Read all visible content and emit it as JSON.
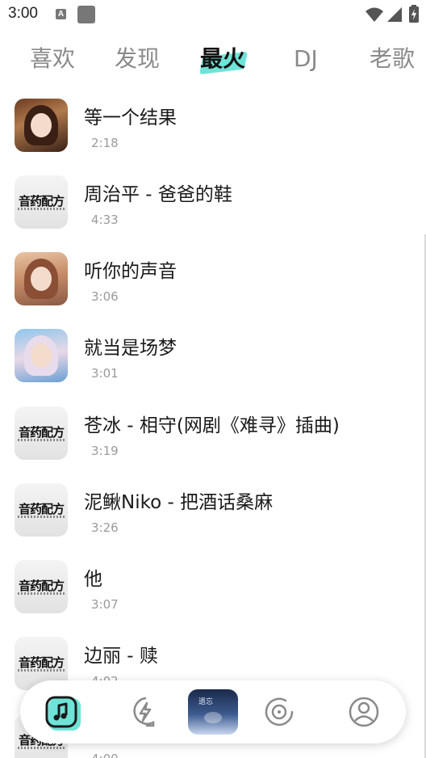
{
  "status_bar": {
    "time": "3:00",
    "notification_icon": "A"
  },
  "tabs": [
    {
      "label": "喜欢",
      "active": false
    },
    {
      "label": "发现",
      "active": false
    },
    {
      "label": "最火",
      "active": true
    },
    {
      "label": "DJ",
      "active": false
    },
    {
      "label": "老歌",
      "active": false
    }
  ],
  "songs": [
    {
      "title": "等一个结果",
      "duration": "2:18",
      "cover": "art1"
    },
    {
      "title": "周治平 - 爸爸的鞋",
      "duration": "4:33",
      "cover": "brand"
    },
    {
      "title": "听你的声音",
      "duration": "3:06",
      "cover": "art2"
    },
    {
      "title": "就当是场梦",
      "duration": "3:01",
      "cover": "art3"
    },
    {
      "title": "苍冰 - 相守(网剧《难寻》插曲)",
      "duration": "3:19",
      "cover": "brand"
    },
    {
      "title": "泥鳅Niko - 把酒话桑麻",
      "duration": "3:26",
      "cover": "brand"
    },
    {
      "title": "他",
      "duration": "3:07",
      "cover": "brand"
    },
    {
      "title": "边丽 - 赎",
      "duration": "4:02",
      "cover": "brand"
    },
    {
      "title": "",
      "duration": "4:00",
      "cover": "brand"
    }
  ],
  "brand_cover_text": "音药配方",
  "bottom_nav": {
    "items": [
      "music-icon",
      "lightning-icon",
      "now-playing-cover",
      "disc-icon",
      "profile-icon"
    ],
    "now_playing_cover_text": "遗忘"
  },
  "colors": {
    "accent": "#6fe3d8",
    "active_tab": "#111111",
    "inactive_tab": "#8a8a8a",
    "duration": "#9a9a9a"
  }
}
